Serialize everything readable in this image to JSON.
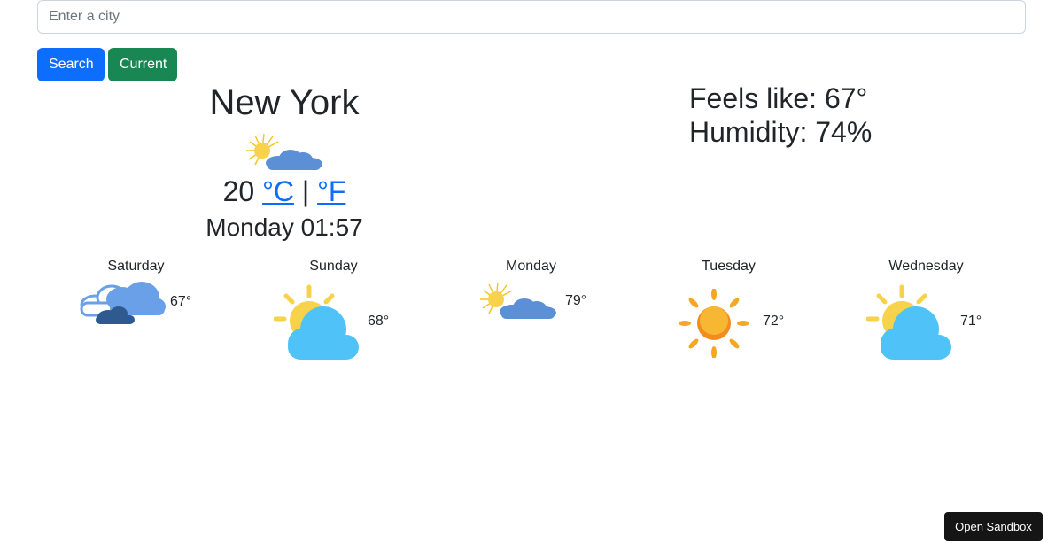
{
  "search": {
    "placeholder": "Enter a city",
    "value": ""
  },
  "buttons": {
    "search_label": "Search",
    "current_label": "Current"
  },
  "current": {
    "city": "New York",
    "icon": "partly-cloudy-icon",
    "temperature": "20",
    "unit_c": "°C",
    "separator": "|",
    "unit_f": "°F",
    "time": "Monday 01:57"
  },
  "details": {
    "feels_like": "Feels like: 67°",
    "humidity": "Humidity: 74%"
  },
  "forecast": [
    {
      "day": "Saturday",
      "temp": "67°",
      "icon": "cloudy-icon"
    },
    {
      "day": "Sunday",
      "temp": "68°",
      "icon": "partly-sunny-icon"
    },
    {
      "day": "Monday",
      "temp": "79°",
      "icon": "partly-cloudy-icon"
    },
    {
      "day": "Tuesday",
      "temp": "72°",
      "icon": "sunny-icon"
    },
    {
      "day": "Wednesday",
      "temp": "71°",
      "icon": "partly-sunny-icon"
    }
  ],
  "sandbox": {
    "label": "Open Sandbox"
  },
  "colors": {
    "primary": "#0d6efd",
    "success": "#198754",
    "text": "#212529",
    "sandbox": "#151515"
  }
}
